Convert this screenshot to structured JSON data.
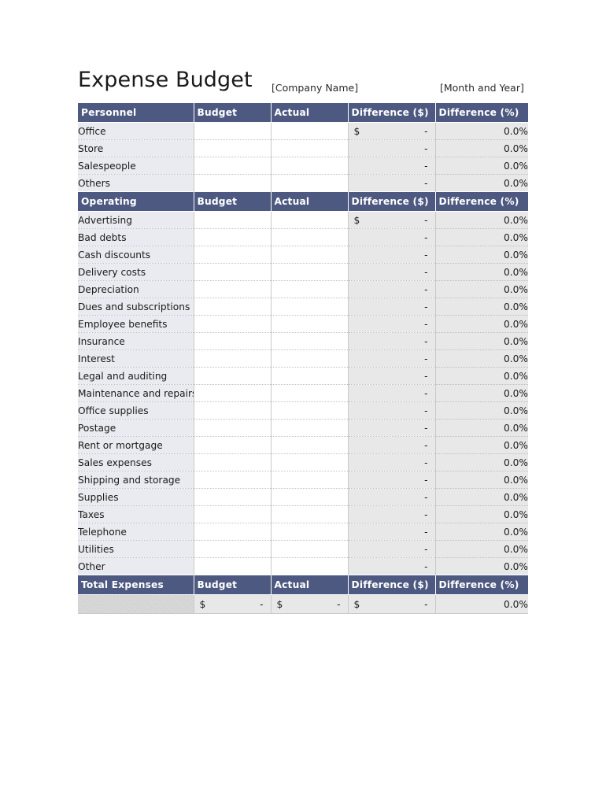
{
  "document": {
    "title": "Expense Budget",
    "company_placeholder": "[Company Name]",
    "period_placeholder": "[Month and Year]"
  },
  "colors": {
    "header_band": "#4d5980",
    "header_text": "#ffffff",
    "label_column": "#eaebf0",
    "value_cell": "#e8e8e8",
    "input_cell": "#ffffff"
  },
  "columns": {
    "budget": "Budget",
    "actual": "Actual",
    "difference_dollar": "Difference ($)",
    "difference_percent": "Difference (%)"
  },
  "values": {
    "currency_symbol": "$",
    "dash": "-",
    "zero_percent": "0.0%",
    "empty": ""
  },
  "sections": [
    {
      "heading": "Personnel",
      "rows": [
        {
          "label": "Office",
          "budget": "",
          "actual": "",
          "diff_currency": "$",
          "diff_value": "-",
          "diff_percent": "0.0%"
        },
        {
          "label": "Store",
          "budget": "",
          "actual": "",
          "diff_currency": "",
          "diff_value": "-",
          "diff_percent": "0.0%"
        },
        {
          "label": "Salespeople",
          "budget": "",
          "actual": "",
          "diff_currency": "",
          "diff_value": "-",
          "diff_percent": "0.0%"
        },
        {
          "label": "Others",
          "budget": "",
          "actual": "",
          "diff_currency": "",
          "diff_value": "-",
          "diff_percent": "0.0%"
        }
      ]
    },
    {
      "heading": "Operating",
      "rows": [
        {
          "label": "Advertising",
          "budget": "",
          "actual": "",
          "diff_currency": "$",
          "diff_value": "-",
          "diff_percent": "0.0%"
        },
        {
          "label": "Bad debts",
          "budget": "",
          "actual": "",
          "diff_currency": "",
          "diff_value": "-",
          "diff_percent": "0.0%"
        },
        {
          "label": "Cash discounts",
          "budget": "",
          "actual": "",
          "diff_currency": "",
          "diff_value": "-",
          "diff_percent": "0.0%"
        },
        {
          "label": "Delivery costs",
          "budget": "",
          "actual": "",
          "diff_currency": "",
          "diff_value": "-",
          "diff_percent": "0.0%"
        },
        {
          "label": "Depreciation",
          "budget": "",
          "actual": "",
          "diff_currency": "",
          "diff_value": "-",
          "diff_percent": "0.0%"
        },
        {
          "label": "Dues and subscriptions",
          "budget": "",
          "actual": "",
          "diff_currency": "",
          "diff_value": "-",
          "diff_percent": "0.0%"
        },
        {
          "label": "Employee benefits",
          "budget": "",
          "actual": "",
          "diff_currency": "",
          "diff_value": "-",
          "diff_percent": "0.0%"
        },
        {
          "label": "Insurance",
          "budget": "",
          "actual": "",
          "diff_currency": "",
          "diff_value": "-",
          "diff_percent": "0.0%"
        },
        {
          "label": "Interest",
          "budget": "",
          "actual": "",
          "diff_currency": "",
          "diff_value": "-",
          "diff_percent": "0.0%"
        },
        {
          "label": "Legal and auditing",
          "budget": "",
          "actual": "",
          "diff_currency": "",
          "diff_value": "-",
          "diff_percent": "0.0%"
        },
        {
          "label": "Maintenance and repairs",
          "budget": "",
          "actual": "",
          "diff_currency": "",
          "diff_value": "-",
          "diff_percent": "0.0%"
        },
        {
          "label": "Office supplies",
          "budget": "",
          "actual": "",
          "diff_currency": "",
          "diff_value": "-",
          "diff_percent": "0.0%"
        },
        {
          "label": "Postage",
          "budget": "",
          "actual": "",
          "diff_currency": "",
          "diff_value": "-",
          "diff_percent": "0.0%"
        },
        {
          "label": "Rent or mortgage",
          "budget": "",
          "actual": "",
          "diff_currency": "",
          "diff_value": "-",
          "diff_percent": "0.0%"
        },
        {
          "label": "Sales expenses",
          "budget": "",
          "actual": "",
          "diff_currency": "",
          "diff_value": "-",
          "diff_percent": "0.0%"
        },
        {
          "label": "Shipping and storage",
          "budget": "",
          "actual": "",
          "diff_currency": "",
          "diff_value": "-",
          "diff_percent": "0.0%"
        },
        {
          "label": "Supplies",
          "budget": "",
          "actual": "",
          "diff_currency": "",
          "diff_value": "-",
          "diff_percent": "0.0%"
        },
        {
          "label": "Taxes",
          "budget": "",
          "actual": "",
          "diff_currency": "",
          "diff_value": "-",
          "diff_percent": "0.0%"
        },
        {
          "label": "Telephone",
          "budget": "",
          "actual": "",
          "diff_currency": "",
          "diff_value": "-",
          "diff_percent": "0.0%"
        },
        {
          "label": "Utilities",
          "budget": "",
          "actual": "",
          "diff_currency": "",
          "diff_value": "-",
          "diff_percent": "0.0%"
        },
        {
          "label": "Other",
          "budget": "",
          "actual": "",
          "diff_currency": "",
          "diff_value": "-",
          "diff_percent": "0.0%"
        }
      ]
    }
  ],
  "total": {
    "heading": "Total  Expenses",
    "label": "",
    "budget_currency": "$",
    "budget_value": "-",
    "actual_currency": "$",
    "actual_value": "-",
    "diff_currency": "$",
    "diff_value": "-",
    "diff_percent": "0.0%"
  }
}
